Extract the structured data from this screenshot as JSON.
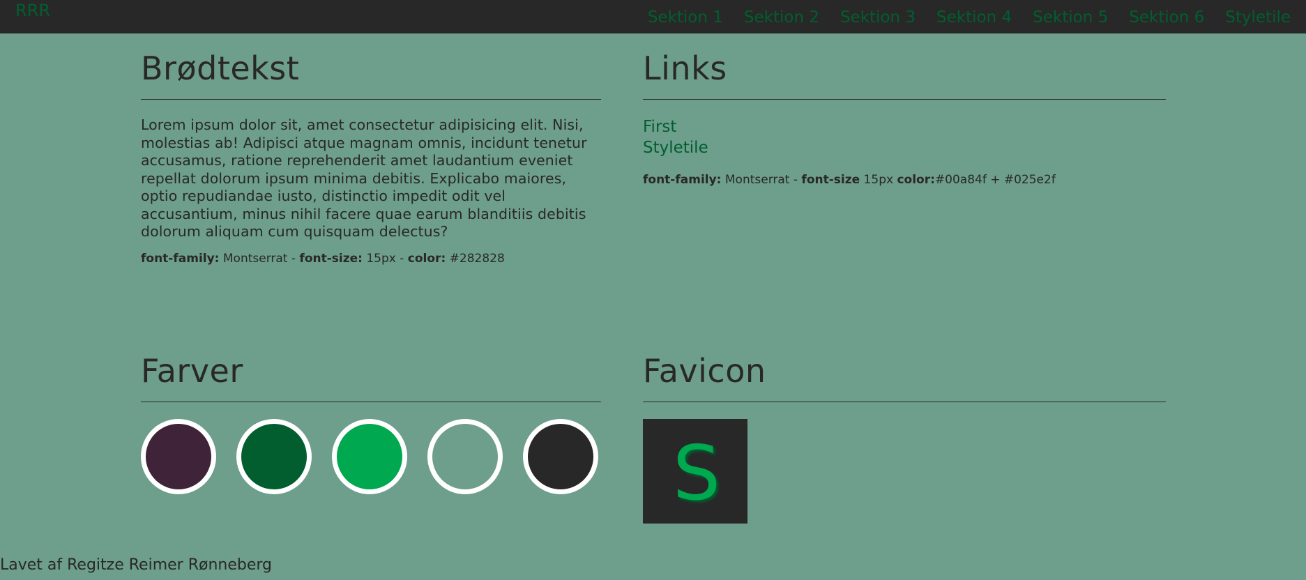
{
  "header": {
    "logo": "RRR",
    "nav": [
      {
        "label": "Sektion 1"
      },
      {
        "label": "Sektion 2"
      },
      {
        "label": "Sektion 3"
      },
      {
        "label": "Sektion 4"
      },
      {
        "label": "Sektion 5"
      },
      {
        "label": "Sektion 6"
      },
      {
        "label": "Styletile"
      }
    ]
  },
  "body_text": {
    "heading": "Brødtekst",
    "paragraph": "Lorem ipsum dolor sit, amet consectetur adipisicing elit. Nisi, molestias ab! Adipisci atque magnam omnis, incidunt tenetur accusamus, ratione reprehenderit amet laudantium eveniet repellat dolorum ipsum minima debitis. Explicabo maiores, optio repudiandae iusto, distinctio impedit odit vel accusantium, minus nihil facere quae earum blanditiis debitis dolorum aliquam cum quisquam delectus?",
    "spec": {
      "family_label": "font-family:",
      "family_value": " Montserrat - ",
      "size_label": "font-size:",
      "size_value": " 15px - ",
      "color_label": "color:",
      "color_value": " #282828"
    }
  },
  "links": {
    "heading": "Links",
    "items": [
      {
        "label": "First"
      },
      {
        "label": "Styletile"
      }
    ],
    "spec": {
      "family_label": "font-family:",
      "family_value": " Montserrat - ",
      "size_label": "font-size",
      "size_value": " 15px ",
      "color_label": "color:",
      "color_value": "#00a84f + #025e2f"
    }
  },
  "colors": {
    "heading": "Farver",
    "swatches": [
      "#3e2339",
      "#025e2f",
      "#00a84f",
      "#6e9e8c",
      "#282828"
    ]
  },
  "favicon": {
    "heading": "Favicon",
    "letter": "S"
  },
  "footer": {
    "text": "Lavet af Regitze Reimer Rønneberg"
  },
  "theme": {
    "background": "#6e9e8c",
    "dark": "#282828",
    "link_green": "#025e2f",
    "accent_green": "#00a84f",
    "swatch_border": "#ffffff"
  }
}
